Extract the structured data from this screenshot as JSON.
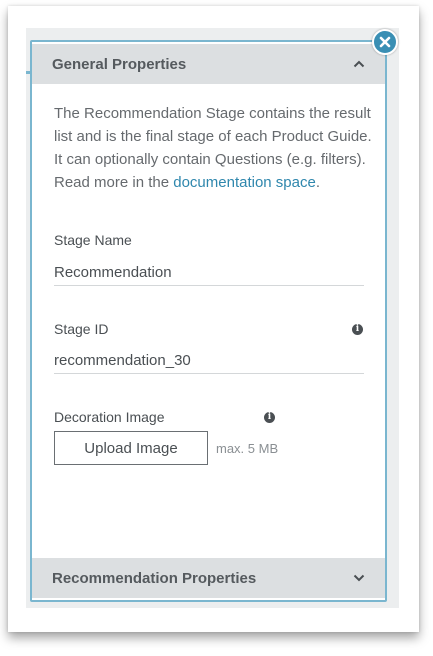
{
  "general": {
    "title": "General Properties",
    "description": "The Recommendation Stage contains the result list and is the final stage of each Product Guide. It can optionally contain Questions (e.g. filters).",
    "read_more_prefix": "Read more in the ",
    "read_more_link": "documentation space",
    "read_more_suffix": "."
  },
  "fields": {
    "stage_name": {
      "label": "Stage Name",
      "value": "Recommendation"
    },
    "stage_id": {
      "label": "Stage ID",
      "value": "recommendation_30"
    },
    "decoration_image": {
      "label": "Decoration Image",
      "button": "Upload Image",
      "max_size": "max. 5 MB"
    }
  },
  "recommendation": {
    "title": "Recommendation Properties"
  },
  "icons": {
    "close": "close-icon",
    "info": "info-icon",
    "chevron_up": "chevron-up-icon",
    "chevron_down": "chevron-down-icon"
  },
  "colors": {
    "accent": "#3a8fb4",
    "border": "#7ab6cf",
    "link": "#2f87ad",
    "header_bg": "#dcdfe1"
  }
}
